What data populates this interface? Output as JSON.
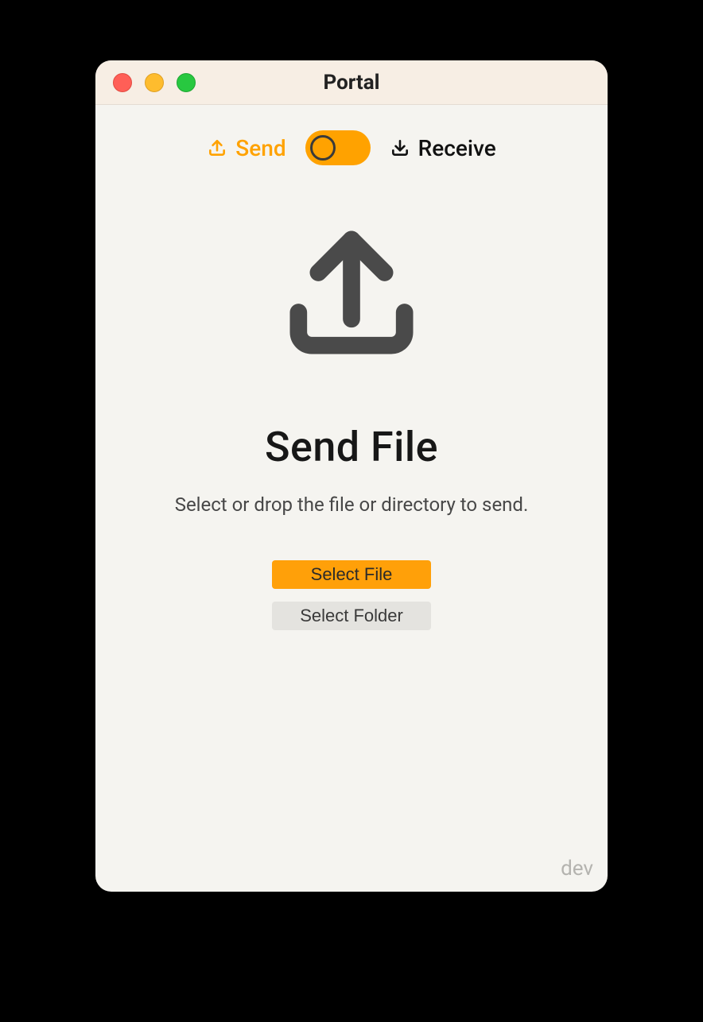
{
  "window": {
    "title": "Portal"
  },
  "mode": {
    "send_label": "Send",
    "receive_label": "Receive",
    "active": "send"
  },
  "main": {
    "headline": "Send File",
    "subtext": "Select or drop the file or directory to send."
  },
  "buttons": {
    "select_file": "Select File",
    "select_folder": "Select Folder"
  },
  "footer": {
    "build_label": "dev"
  },
  "colors": {
    "accent": "#ffa009",
    "icon_dark": "#4a4a4a"
  }
}
